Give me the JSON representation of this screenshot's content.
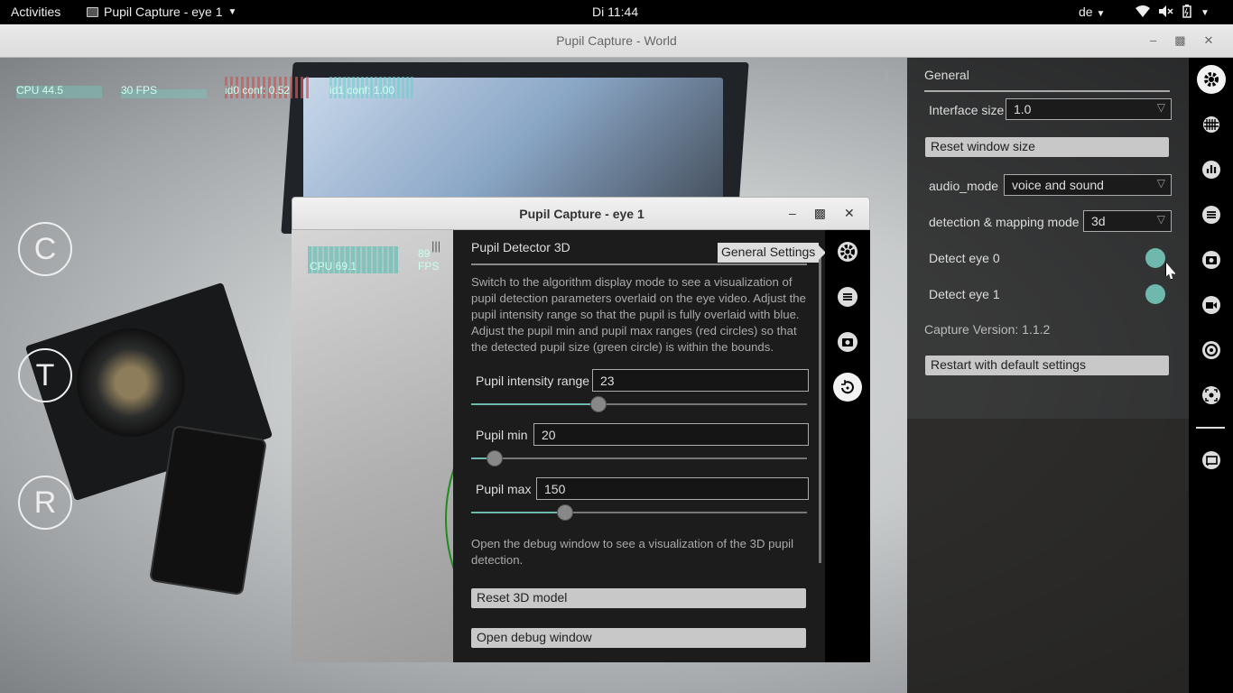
{
  "topbar": {
    "activities": "Activities",
    "app_name": "Pupil Capture - eye 1",
    "clock": "Di 11:44",
    "lang": "de",
    "tray_icons": [
      "wifi-icon",
      "volume-muted-icon",
      "battery-icon",
      "power-icon"
    ]
  },
  "world": {
    "title": "Pupil Capture - World",
    "hud": {
      "cpu": "CPU 44.5",
      "fps": "30 FPS",
      "id0": "id0 conf: 0.52",
      "id1": "id1 conf: 1.00"
    },
    "side_buttons": [
      "C",
      "T",
      "R"
    ],
    "general": {
      "title": "General",
      "interface_size_label": "Interface size",
      "interface_size_value": "1.0",
      "reset_window_size": "Reset window size",
      "audio_mode_label": "audio_mode",
      "audio_mode_value": "voice and sound",
      "detection_label": "detection & mapping mode",
      "detection_value": "3d",
      "detect_eye0_label": "Detect eye 0",
      "detect_eye0_on": true,
      "detect_eye1_label": "Detect eye 1",
      "detect_eye1_on": true,
      "version": "Capture Version: 1.1.2",
      "restart_default": "Restart with default settings"
    },
    "iconbar": [
      "gear-icon",
      "calibration-grid-icon",
      "bar-chart-icon",
      "list-icon",
      "camera-icon",
      "video-camera-icon",
      "target-icon",
      "focus-icon",
      "cast-icon"
    ]
  },
  "eye": {
    "title": "Pupil Capture - eye 1",
    "hud": {
      "cpu": "CPU 69.1",
      "fps": "89 FPS"
    },
    "panel": {
      "title": "Pupil Detector 3D",
      "intro": "Switch to the algorithm display mode to see a visualization of pupil detection parameters overlaid on the eye video. Adjust the pupil intensity range so that the pupil is fully overlaid with blue. Adjust the pupil min and pupil max ranges (red circles) so that the detected pupil size (green circle) is within the bounds.",
      "intensity_label": "Pupil intensity range",
      "intensity_value": "23",
      "intensity_fraction": 0.38,
      "min_label": "Pupil min",
      "min_value": "20",
      "min_fraction": 0.07,
      "max_label": "Pupil max",
      "max_value": "150",
      "max_fraction": 0.28,
      "debug_text": "Open the debug window to see a visualization of the 3D pupil detection.",
      "reset_model": "Reset 3D model",
      "open_debug": "Open debug window"
    },
    "tooltip": "General Settings",
    "iconbar": [
      "gear-icon",
      "list-icon",
      "camera-icon",
      "3d-detector-icon"
    ],
    "accent_color": "#6fb8ae"
  }
}
